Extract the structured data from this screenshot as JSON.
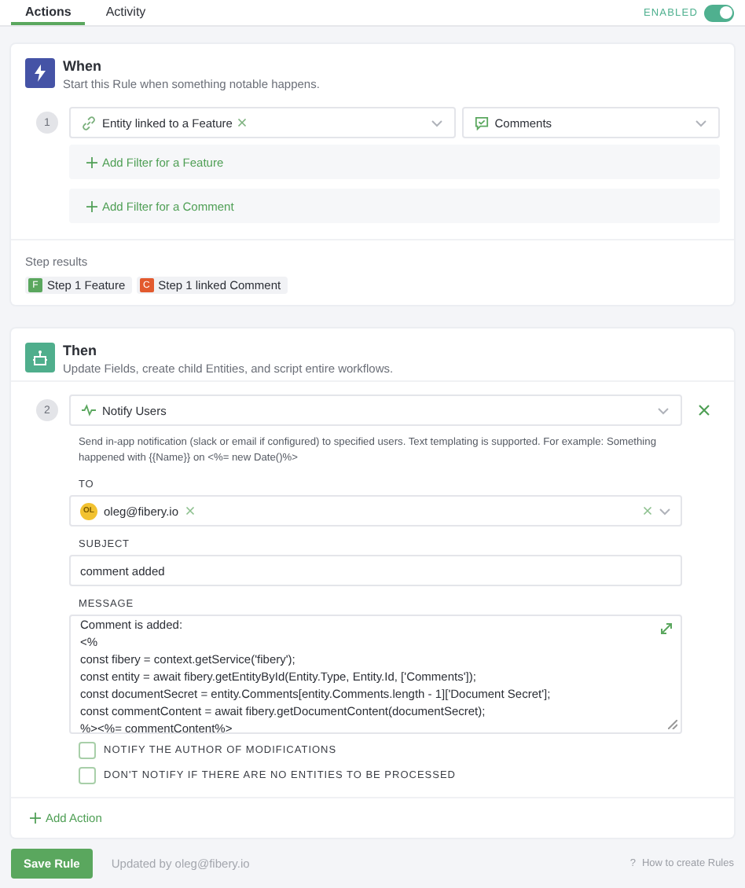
{
  "tabs": [
    {
      "label": "Actions",
      "selected": true
    },
    {
      "label": "Activity",
      "selected": false
    }
  ],
  "toggle": {
    "label": "ENABLED",
    "on": true
  },
  "when": {
    "title": "When",
    "subtitle": "Start this Rule when something notable happens.",
    "step_number": "1",
    "trigger": "Entity linked to a Feature",
    "type_select": "Comments",
    "filters": [
      "Add Filter for a Feature",
      "Add Filter for a Comment"
    ],
    "step_results": {
      "title": "Step results",
      "chips": [
        {
          "badge": "F",
          "label": "Step 1 Feature",
          "color": "#5aa75e"
        },
        {
          "badge": "C",
          "label": "Step 1 linked Comment",
          "color": "#e25a2e"
        }
      ]
    }
  },
  "then": {
    "title": "Then",
    "subtitle": "Update Fields, create child Entities, and script entire workflows.",
    "step_number": "2",
    "action": "Notify Users",
    "description": "Send in-app notification (slack or email if configured) to specified users. Text templating is supported. For example: Something happened with {{Name}} on <%= new Date()%>",
    "to": {
      "label": "TO",
      "users": [
        {
          "initials": "OL",
          "email": "oleg@fibery.io"
        }
      ]
    },
    "subject": {
      "label": "SUBJECT",
      "value": "comment added"
    },
    "message": {
      "label": "MESSAGE",
      "lines": [
        "Comment is added:",
        "<%",
        "const fibery = context.getService('fibery');",
        "const entity = await fibery.getEntityById(Entity.Type, Entity.Id, ['Comments']);",
        "const documentSecret = entity.Comments[entity.Comments.length - 1]['Document Secret'];",
        "const commentContent = await fibery.getDocumentContent(documentSecret);",
        "%><%= commentContent%>"
      ]
    },
    "options": [
      {
        "label": "NOTIFY THE AUTHOR OF MODIFICATIONS",
        "checked": false
      },
      {
        "label": "DON'T NOTIFY IF THERE ARE NO ENTITIES TO BE PROCESSED",
        "checked": false
      }
    ],
    "add_action": "Add Action"
  },
  "footer": {
    "save": "Save Rule",
    "updated": "Updated by oleg@fibery.io",
    "help_mark": "?",
    "help": "How to create Rules"
  }
}
